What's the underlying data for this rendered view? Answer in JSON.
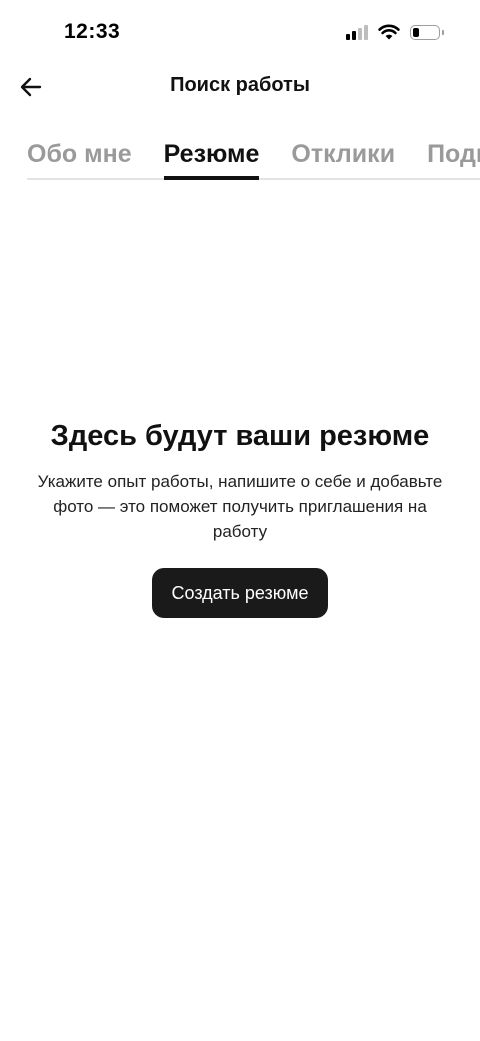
{
  "status_bar": {
    "time": "12:33",
    "battery_level": 0.25
  },
  "header": {
    "title": "Поиск работы"
  },
  "tabs": [
    {
      "label": "Обо мне",
      "active": false
    },
    {
      "label": "Резюме",
      "active": true
    },
    {
      "label": "Отклики",
      "active": false
    },
    {
      "label": "Подписки",
      "active": false
    }
  ],
  "empty_state": {
    "title": "Здесь будут ваши резюме",
    "description": "Укажите опыт работы, напишите о себе и добавьте фото — это поможет получить приглашения на работу",
    "button_label": "Создать резюме"
  },
  "colors": {
    "active_text": "#111111",
    "inactive_tab": "#9a9a9a",
    "button_bg": "#1a1a1a"
  }
}
